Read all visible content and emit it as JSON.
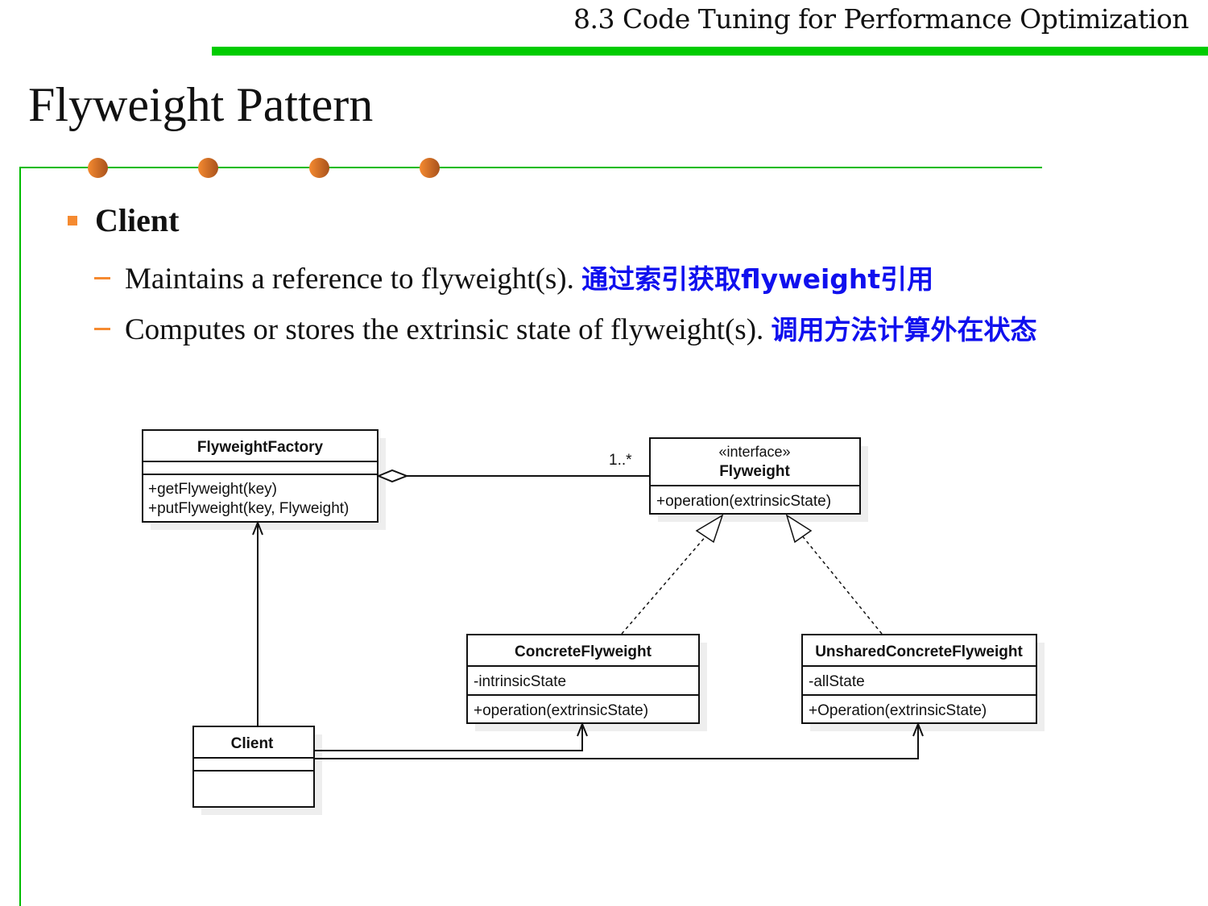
{
  "header": {
    "section": "8.3 Code Tuning for Performance Optimization"
  },
  "title": "Flyweight Pattern",
  "bullet": {
    "heading": "Client",
    "items": [
      {
        "text": "Maintains a reference to flyweight(s).",
        "note": "通过索引获取flyweight引用"
      },
      {
        "text": "Computes or stores the extrinsic state of flyweight(s).",
        "note": "调用方法计算外在状态"
      }
    ]
  },
  "diagram": {
    "factory": {
      "name": "FlyweightFactory",
      "ops": [
        "+getFlyweight(key)",
        "+putFlyweight(key, Flyweight)"
      ]
    },
    "flyweight": {
      "stereotype": "«interface»",
      "name": "Flyweight",
      "ops": [
        "+operation(extrinsicState)"
      ]
    },
    "concrete": {
      "name": "ConcreteFlyweight",
      "attrs": [
        "-intrinsicState"
      ],
      "ops": [
        "+operation(extrinsicState)"
      ]
    },
    "unshared": {
      "name": "UnsharedConcreteFlyweight",
      "attrs": [
        "-allState"
      ],
      "ops": [
        "+Operation(extrinsicState)"
      ]
    },
    "client": {
      "name": "Client"
    },
    "multiplicity": "1..*"
  }
}
